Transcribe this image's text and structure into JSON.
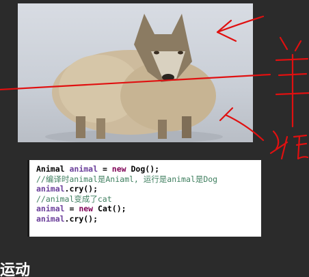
{
  "image": {
    "subject": "wolf-in-sheeps-clothing",
    "icon": "sheep-wolf-photo"
  },
  "code": {
    "lines": [
      {
        "parts": [
          {
            "t": "Animal ",
            "c": "plain"
          },
          {
            "t": "animal",
            "c": "var"
          },
          {
            "t": " = ",
            "c": "plain"
          },
          {
            "t": "new",
            "c": "kw"
          },
          {
            "t": " Dog();",
            "c": "plain"
          }
        ]
      },
      {
        "parts": [
          {
            "t": "//编译时animal是Aniaml, 运行是animal是Dog",
            "c": "comment"
          }
        ]
      },
      {
        "parts": [
          {
            "t": "animal",
            "c": "var"
          },
          {
            "t": ".cry();",
            "c": "plain"
          }
        ]
      },
      {
        "parts": [
          {
            "t": "//animal变成了cat",
            "c": "comment"
          }
        ]
      },
      {
        "parts": [
          {
            "t": "animal",
            "c": "var"
          },
          {
            "t": " = ",
            "c": "plain"
          },
          {
            "t": "new",
            "c": "kw"
          },
          {
            "t": " Cat();",
            "c": "plain"
          }
        ]
      },
      {
        "parts": [
          {
            "t": "animal",
            "c": "var"
          },
          {
            "t": ".cry();",
            "c": "plain"
          }
        ]
      }
    ]
  },
  "annotations": {
    "color": "#e01010",
    "handwriting": "羊 狼"
  },
  "bottom_label": "运动",
  "colors": {
    "background": "#2b2b2b",
    "keyword": "#7f0055",
    "comment": "#3f7f5f",
    "variable": "#6a3e9a"
  }
}
